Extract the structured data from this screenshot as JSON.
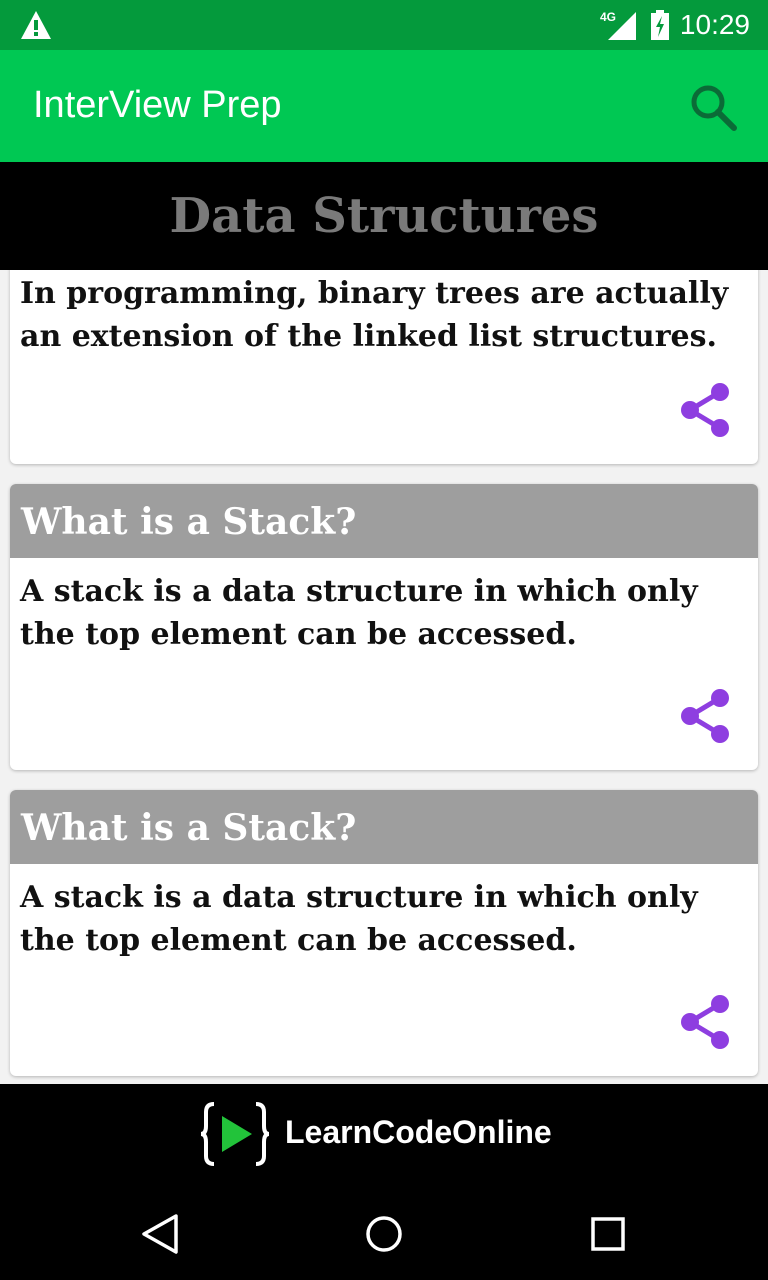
{
  "status_bar": {
    "network": "4G",
    "time": "10:29",
    "icons": [
      "warning-icon",
      "signal-icon",
      "battery-charging-icon"
    ]
  },
  "app_bar": {
    "title": "InterView Prep",
    "search_icon": "search-icon"
  },
  "section": {
    "title": "Data Structures"
  },
  "cards": [
    {
      "question": "",
      "answer": "In programming, binary trees are actually an extension of the linked list structures."
    },
    {
      "question": "What is a Stack?",
      "answer": "A stack is a data structure in which only the top element can be accessed."
    },
    {
      "question": "What is a Stack?",
      "answer": "A stack is a data structure in which only the top element can be accessed."
    }
  ],
  "footer": {
    "brand": "LearnCodeOnline",
    "logo_icon": "learncodeonline-logo-icon"
  },
  "nav_bar": {
    "icons": [
      "back-icon",
      "home-icon",
      "recents-icon"
    ]
  },
  "colors": {
    "status_bar": "#049a3c",
    "app_bar": "#00c853",
    "question_header": "#9e9e9e",
    "share_icon": "#8e3ee0",
    "section_title": "#7a7a7a"
  }
}
